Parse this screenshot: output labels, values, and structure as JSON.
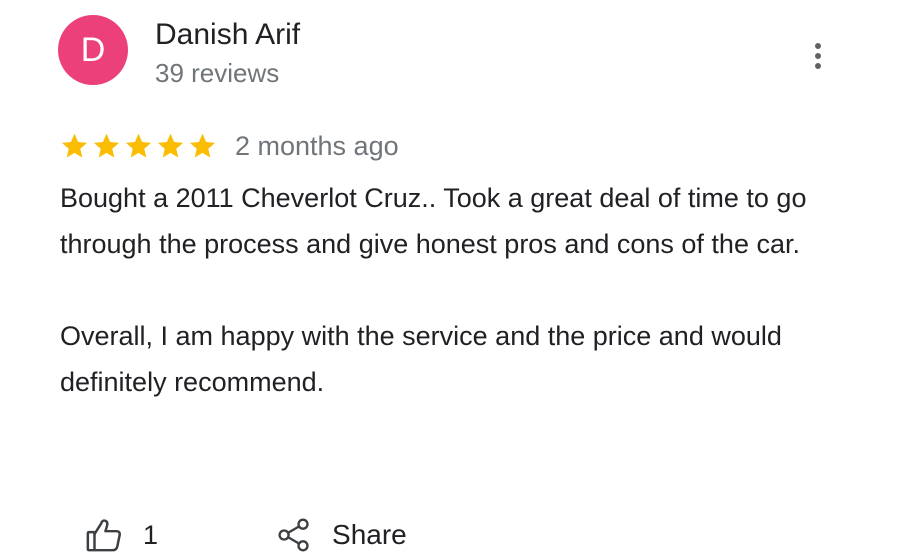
{
  "reviewer": {
    "initial": "D",
    "avatar_color": "#ec407a",
    "name": "Danish Arif",
    "review_count": "39 reviews"
  },
  "menu": {
    "icon": "more-vert-icon"
  },
  "review": {
    "rating": 5,
    "max_rating": 5,
    "star_color": "#fbbc04",
    "date": "2 months ago",
    "paragraphs": [
      "Bought a 2011 Cheverlot Cruz.. Took a great deal of time to go through the process and give honest pros and cons of the car.",
      "Overall, I am happy with the service and the price and would definitely recommend."
    ]
  },
  "actions": {
    "like_icon": "thumb-up-icon",
    "like_count": "1",
    "share_icon": "share-icon",
    "share_label": "Share"
  }
}
